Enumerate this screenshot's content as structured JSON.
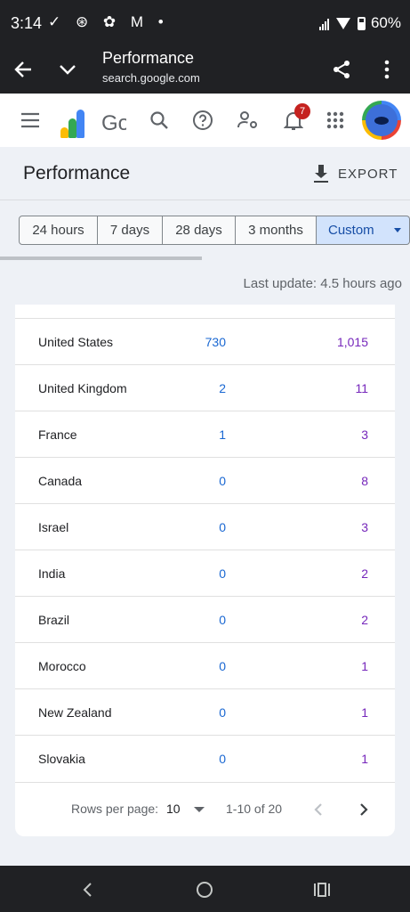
{
  "status_bar": {
    "time": "3:14",
    "notifications": "✓ ⊛ ✿ M •",
    "battery": "60%"
  },
  "browser": {
    "title": "Performance",
    "url": "search.google.com"
  },
  "app_header": {
    "logo_text": "Go",
    "notification_count": "7"
  },
  "page": {
    "title": "Performance",
    "export_label": "EXPORT"
  },
  "date_ranges": [
    "24 hours",
    "7 days",
    "28 days",
    "3 months",
    "Custom"
  ],
  "last_update": "Last update: 4.5 hours ago",
  "table": {
    "rows": [
      {
        "country": "United States",
        "clicks": "730",
        "impressions": "1,015"
      },
      {
        "country": "United Kingdom",
        "clicks": "2",
        "impressions": "11"
      },
      {
        "country": "France",
        "clicks": "1",
        "impressions": "3"
      },
      {
        "country": "Canada",
        "clicks": "0",
        "impressions": "8"
      },
      {
        "country": "Israel",
        "clicks": "0",
        "impressions": "3"
      },
      {
        "country": "India",
        "clicks": "0",
        "impressions": "2"
      },
      {
        "country": "Brazil",
        "clicks": "0",
        "impressions": "2"
      },
      {
        "country": "Morocco",
        "clicks": "0",
        "impressions": "1"
      },
      {
        "country": "New Zealand",
        "clicks": "0",
        "impressions": "1"
      },
      {
        "country": "Slovakia",
        "clicks": "0",
        "impressions": "1"
      }
    ]
  },
  "pagination": {
    "rows_per_page_label": "Rows per page:",
    "rows_per_page": "10",
    "range": "1-10 of 20"
  },
  "colors": {
    "clicks": "#1967d2",
    "impressions": "#7627bb",
    "selected_range": "#d2e3fc"
  }
}
